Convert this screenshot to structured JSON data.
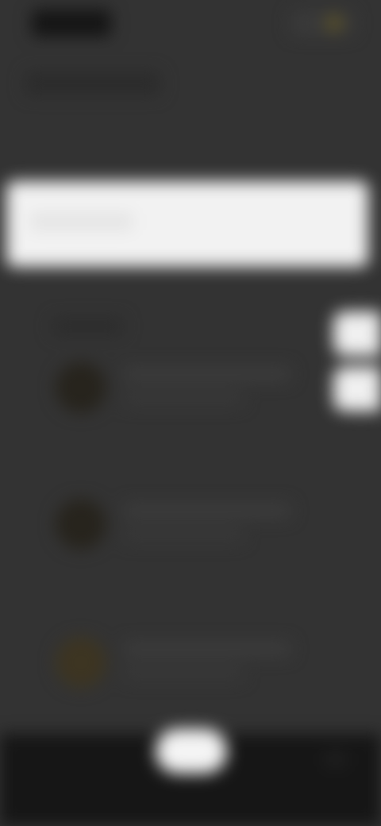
{
  "screen": {
    "state": "blurred",
    "theme": "dark"
  },
  "status_bar": {
    "time_text": "",
    "icons": [
      "signal-icon",
      "battery-icon"
    ]
  },
  "header": {
    "title": ""
  },
  "banner": {
    "text": ""
  },
  "list": {
    "section_label": "",
    "items": [
      {
        "title": "",
        "subtitle": "",
        "avatar_color": "#27241d"
      },
      {
        "title": "",
        "subtitle": "",
        "avatar_color": "#27241d"
      },
      {
        "title": "",
        "subtitle": "",
        "avatar_color": "#3d3522"
      }
    ]
  },
  "side_actions": [
    {
      "icon": "action-icon"
    },
    {
      "icon": "action-icon"
    }
  ],
  "navigation": {
    "home_button": "home-pill"
  },
  "colors": {
    "background": "#333333",
    "banner": "#f2f2f2",
    "nav_bar": "#161616",
    "accent": "#5b5228"
  }
}
